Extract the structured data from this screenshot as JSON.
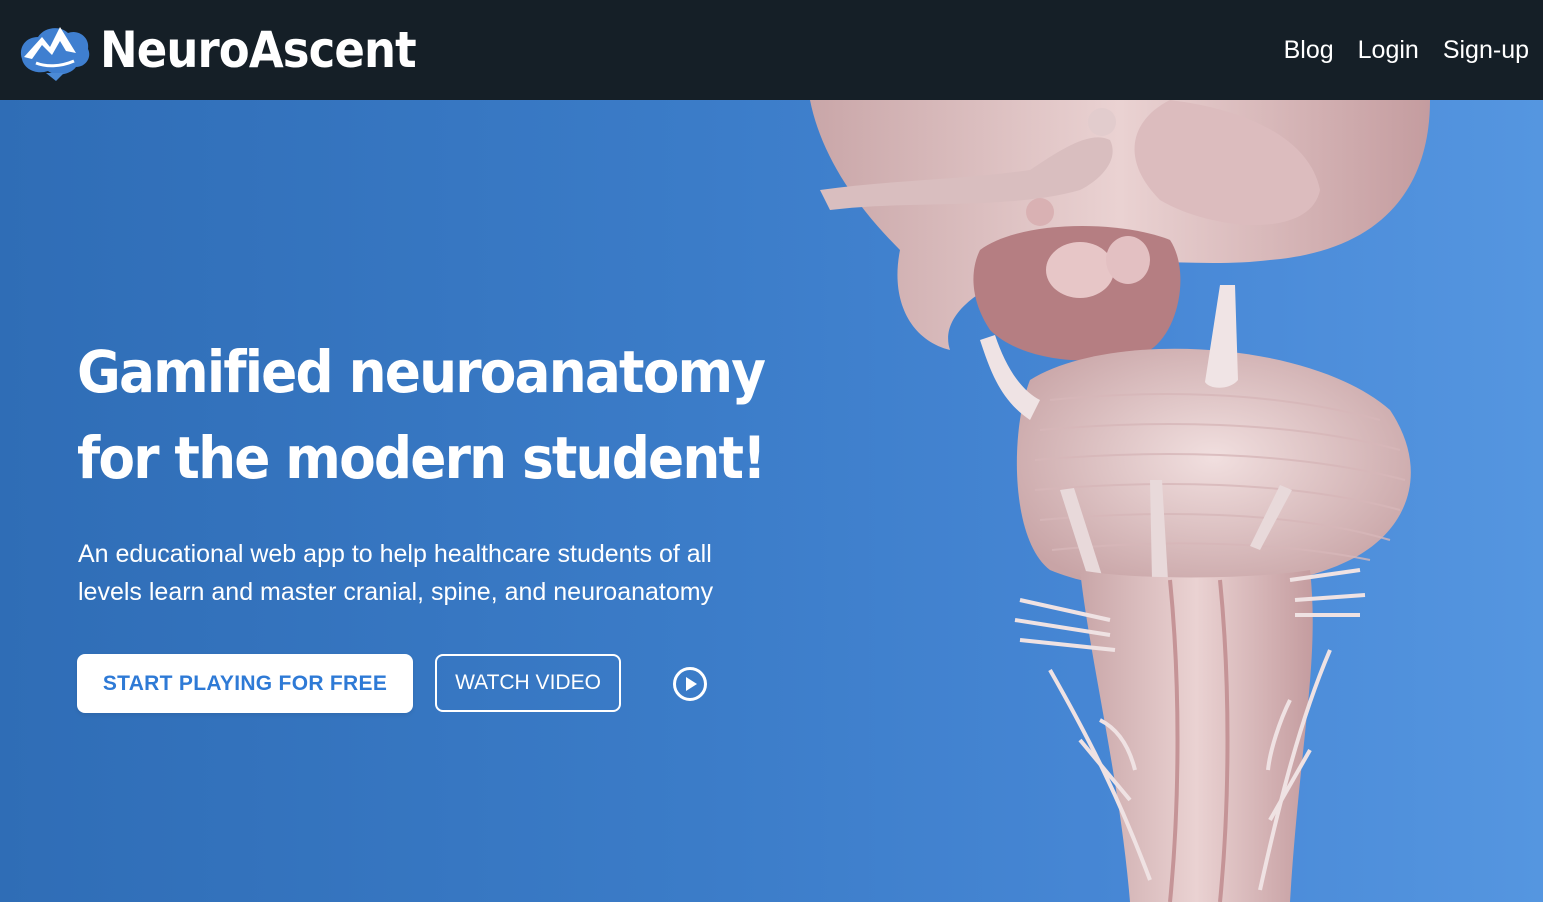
{
  "header": {
    "brand": "NeuroAscent",
    "nav": [
      {
        "label": "Blog"
      },
      {
        "label": "Login"
      },
      {
        "label": "Sign-up"
      }
    ]
  },
  "hero": {
    "headline_line1": "Gamified neuroanatomy",
    "headline_line2": "for the modern student!",
    "subtitle": "An educational web app to help healthcare students of all levels learn and master cranial, spine, and neuroanatomy",
    "cta_primary": "START PLAYING FOR FREE",
    "cta_secondary": "WATCH VIDEO",
    "play_icon": "play-circle-icon",
    "illustration": "brainstem-3d-render"
  },
  "colors": {
    "topbar": "#151f27",
    "hero_gradient_start": "#2f6db6",
    "hero_gradient_end": "#5596e0",
    "cta_text": "#2e7ad6"
  }
}
